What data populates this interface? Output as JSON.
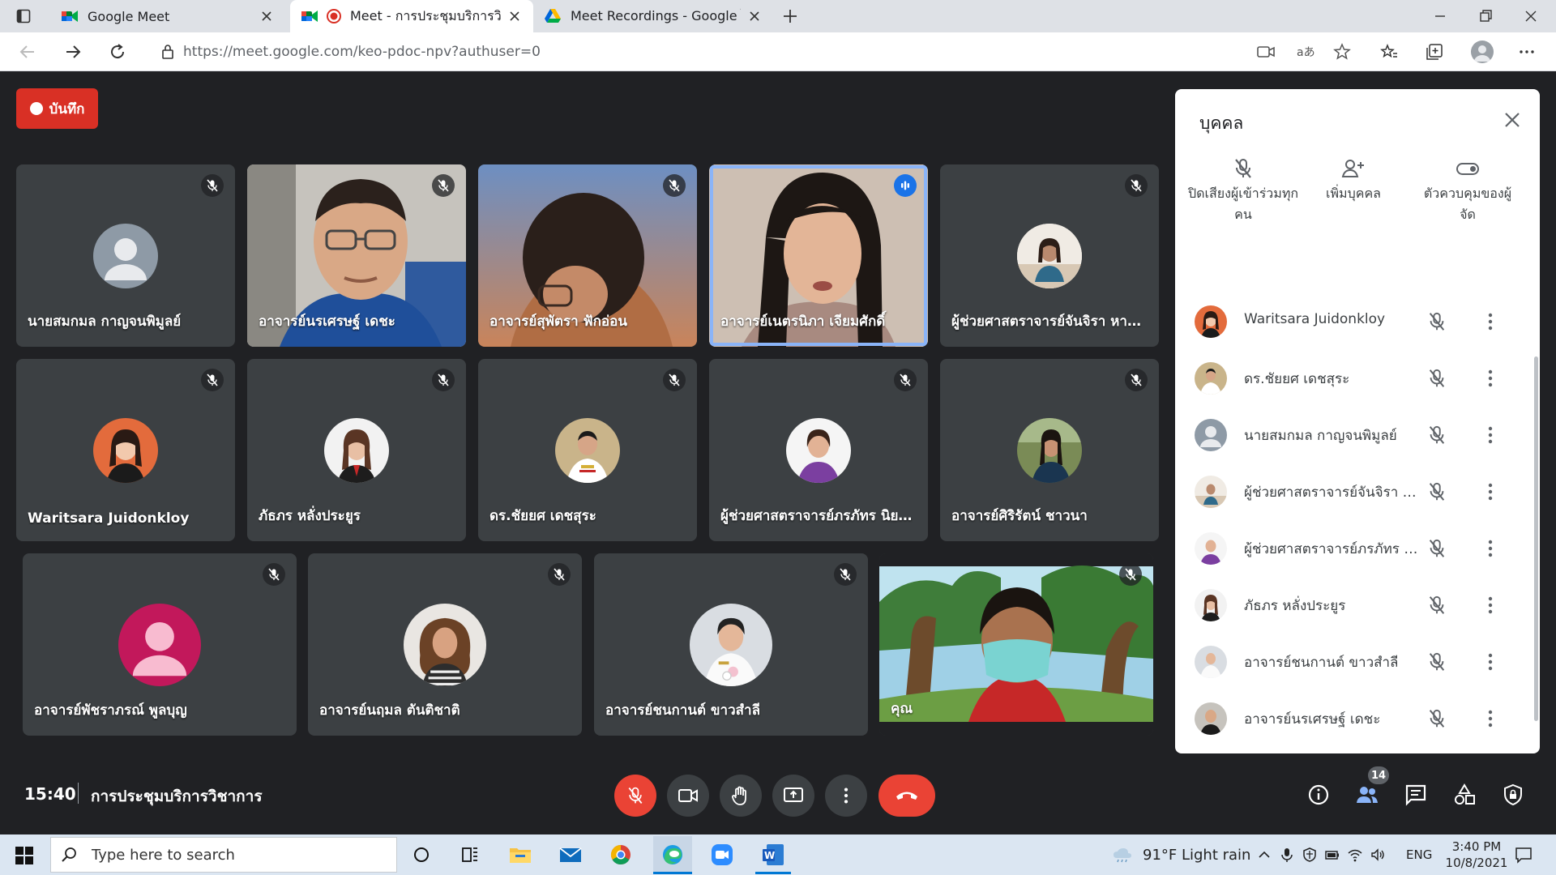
{
  "browser": {
    "tabs": [
      {
        "title": "Google Meet",
        "icon": "meet-icon"
      },
      {
        "title": "Meet - การประชุมบริการวิชาการ",
        "icon": "meet-icon",
        "recording": true
      },
      {
        "title": "Meet Recordings - Google ไดรฟ์",
        "icon": "drive-icon"
      }
    ],
    "url": "https://meet.google.com/keo-pdoc-npv?authuser=0"
  },
  "record_label": "บันทึก",
  "tiles": [
    {
      "name": "นายสมกมล กาญจนพิมูลย์",
      "type": "placeholder",
      "color": "#8e9aa6"
    },
    {
      "name": "อาจารย์นรเศรษฐ์ เดชะ",
      "type": "video"
    },
    {
      "name": "อาจารย์สุพัตรา ฟักอ่อน",
      "type": "video"
    },
    {
      "name": "อาจารย์เนตรนิภา เจียมศักดิ์",
      "type": "video",
      "speaking": true
    },
    {
      "name": "ผู้ช่วยศาสตราจารย์จันจิรา หาวิชา",
      "type": "photo"
    },
    {
      "name": "Waritsara Juidonkloy",
      "type": "photo"
    },
    {
      "name": "ภัธภร หลั่งประยูร",
      "type": "photo"
    },
    {
      "name": "ดร.ชัยยศ เดชสุระ",
      "type": "photo"
    },
    {
      "name": "ผู้ช่วยศาสตราจารย์ภรภัทร นิยมทอง",
      "type": "photo"
    },
    {
      "name": "อาจารย์ศิริรัตน์ ชาวนา",
      "type": "photo"
    },
    {
      "name": "อาจารย์พัชราภรณ์ พูลบุญ",
      "type": "placeholder",
      "color": "#c2185b"
    },
    {
      "name": "อาจารย์นฤมล ตันติชาติ",
      "type": "photo"
    },
    {
      "name": "อาจารย์ชนกานต์ ขาวสำลี",
      "type": "photo"
    },
    {
      "name": "คุณ",
      "type": "self"
    }
  ],
  "people_panel": {
    "title": "บุคคล",
    "actions": [
      {
        "label": "ปิดเสียงผู้เข้าร่วมทุกคน"
      },
      {
        "label": "เพิ่มบุคคล"
      },
      {
        "label": "ตัวควบคุมของผู้จัด"
      }
    ],
    "participants": [
      {
        "name": "Waritsara Juidonkloy"
      },
      {
        "name": "ดร.ชัยยศ เดชสุระ"
      },
      {
        "name": "นายสมกมล กาญจนพิมูลย์"
      },
      {
        "name": "ผู้ช่วยศาสตราจารย์จันจิรา หาวิชา"
      },
      {
        "name": "ผู้ช่วยศาสตราจารย์ภรภัทร นิยมทอง"
      },
      {
        "name": "ภัธภร หลั่งประยูร"
      },
      {
        "name": "อาจารย์ชนกานต์ ขาวสำลี"
      },
      {
        "name": "อาจารย์นรเศรษฐ์ เดชะ"
      }
    ]
  },
  "bottom_bar": {
    "time": "15:40",
    "meeting_name": "การประชุมบริการวิชาการ",
    "people_count": "14"
  },
  "taskbar": {
    "search_placeholder": "Type here to search",
    "weather": "91°F  Light rain",
    "lang": "ENG",
    "time": "3:40 PM",
    "date": "10/8/2021"
  },
  "colors": {
    "meet_bg": "#202124",
    "tile_bg": "#3c4043",
    "danger": "#ea4335",
    "speaking": "#8ab4f8"
  }
}
